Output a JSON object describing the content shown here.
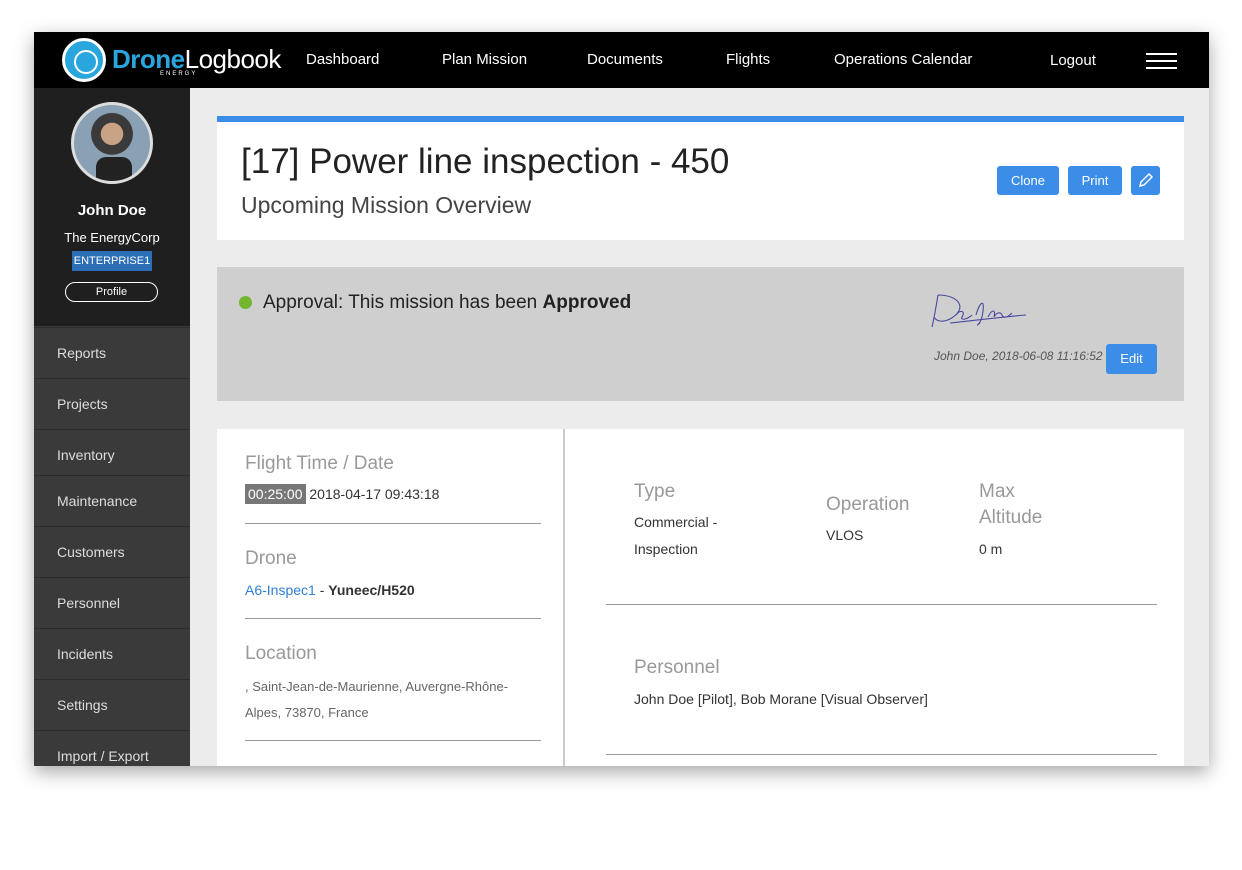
{
  "header": {
    "logo_drone": "Drone",
    "logo_logbook": "Logbook",
    "logo_sub": "ENERGY",
    "nav": [
      "Dashboard",
      "Plan Mission",
      "Documents",
      "Flights",
      "Operations Calendar",
      "Logout"
    ]
  },
  "user": {
    "name": "John Doe",
    "org": "The EnergyCorp",
    "plan": "ENTERPRISE1",
    "profile_label": "Profile"
  },
  "sidebar": {
    "items": [
      "Reports",
      "Projects",
      "Inventory",
      "Maintenance",
      "Customers",
      "Personnel",
      "Incidents",
      "Settings",
      "Import / Export"
    ]
  },
  "mission": {
    "title": "[17] Power line inspection - 450",
    "subtitle": "Upcoming Mission Overview",
    "clone_label": "Clone",
    "print_label": "Print"
  },
  "approval": {
    "prefix": "Approval: This mission has been ",
    "status": "Approved",
    "meta": "John Doe, 2018-06-08 11:16:52",
    "edit_label": "Edit"
  },
  "flight": {
    "label": "Flight Time / Date",
    "duration": "00:25:00",
    "datetime": "2018-04-17 09:43:18"
  },
  "drone": {
    "label": "Drone",
    "id": "A6-Inspec1",
    "separator": " - ",
    "model": "Yuneec/H520"
  },
  "location": {
    "label": "Location",
    "line1": ", Saint-Jean-de-Maurienne, Auvergne-Rhône-",
    "line2": "Alpes, 73870, France"
  },
  "type": {
    "label": "Type",
    "line1": "Commercial -",
    "line2": "Inspection"
  },
  "operation": {
    "label": "Operation",
    "value": "VLOS"
  },
  "altitude": {
    "label1": "Max",
    "label2": "Altitude",
    "value": "0 m"
  },
  "personnel": {
    "label": "Personnel",
    "value": "John Doe [Pilot], Bob Morane [Visual Observer]"
  },
  "colors": {
    "accent": "#3b8de8",
    "approved_dot": "#74b62d",
    "plan_badge": "#2c6fb7"
  }
}
